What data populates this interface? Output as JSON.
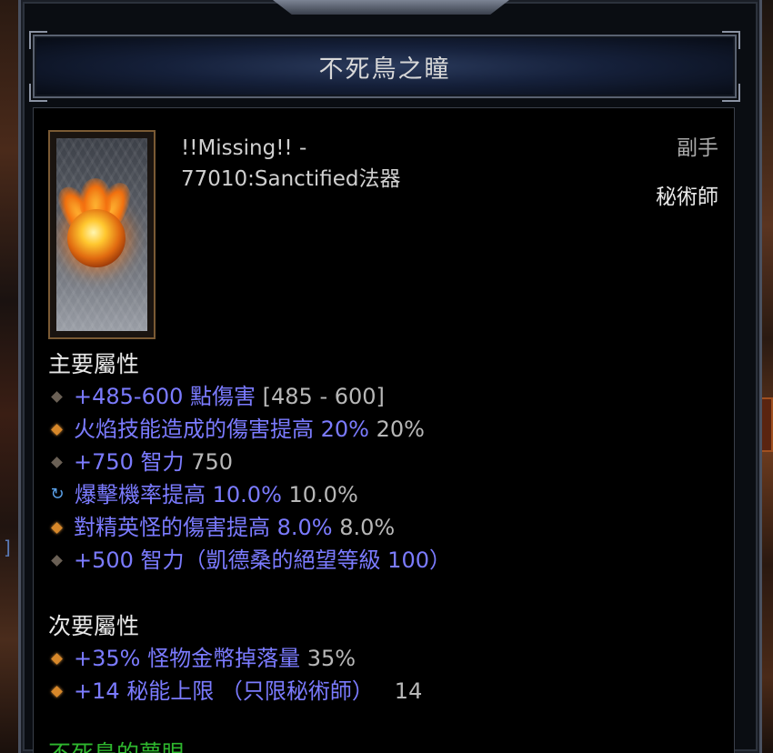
{
  "tooltip": {
    "title": "不死鳥之瞳",
    "item_name_line1": "!!Missing!! -",
    "item_name_line2": "77010:Sanctified法器",
    "slot_type": "副手",
    "class_requirement": "秘術師",
    "primary_header": "主要屬性",
    "primary_affixes": [
      {
        "bullet": "dark",
        "text": "+485-600 點傷害",
        "value": "[485 - 600]"
      },
      {
        "bullet": "orange",
        "text": "火焰技能造成的傷害提高 20%",
        "value": "20%"
      },
      {
        "bullet": "dark",
        "text": "+750 智力",
        "value": "750"
      },
      {
        "bullet": "swap",
        "text": "爆擊機率提高 10.0%",
        "value": "10.0%"
      },
      {
        "bullet": "orange",
        "text": "對精英怪的傷害提高 8.0%",
        "value": "8.0%"
      },
      {
        "bullet": "dark",
        "text": "+500 智力（凱德桑的絕望等級 100）",
        "value": ""
      }
    ],
    "secondary_header": "次要屬性",
    "secondary_affixes": [
      {
        "bullet": "orange",
        "text": "+35% 怪物金幣掉落量",
        "value": "35%"
      },
      {
        "bullet": "orange",
        "text": "+14 秘能上限 （只限秘術師）",
        "value": "14"
      }
    ],
    "set_label": "不死鳥的夢眼"
  },
  "icons": {
    "item": "phoenix-orb-icon",
    "swap_bullet": "reroll-icon"
  },
  "colors": {
    "affix_blue": "#7b7bff",
    "value_gray": "#b8b8b8",
    "set_green": "#2eb82e",
    "bullet_orange": "#d8882a"
  }
}
